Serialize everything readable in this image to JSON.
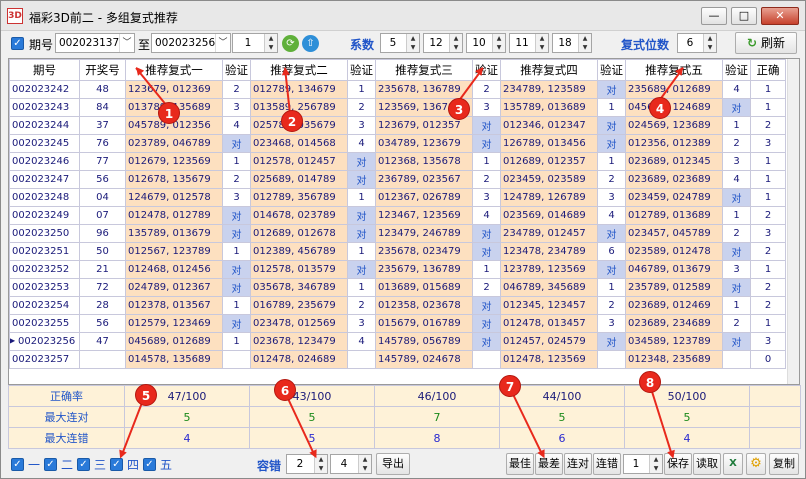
{
  "window": {
    "title": "福彩3D前二 - 多组复式推荐",
    "icon_name": "app-logo-icon",
    "min_label": "▭",
    "max_label": "▢",
    "close_label": "✕"
  },
  "toolbar": {
    "period_label": "期号",
    "period_from": "002023137",
    "to_label": "至",
    "period_to": "002023256",
    "step_value": "1",
    "coef_label": "系数",
    "coefs": [
      "5",
      "12",
      "10",
      "11",
      "18"
    ],
    "fushi_label": "复式位数",
    "fushi_value": "6",
    "refresh_label": "刷新"
  },
  "table": {
    "headers": [
      "期号",
      "开奖号",
      "推荐复式一",
      "验证",
      "推荐复式二",
      "验证",
      "推荐复式三",
      "验证",
      "推荐复式四",
      "验证",
      "推荐复式五",
      "验证",
      "正确"
    ],
    "rows": [
      [
        "002023242",
        "48",
        "123679, 012369",
        "2",
        "012789, 134679",
        "1",
        "235678, 136789",
        "2",
        "234789, 123589",
        "对",
        "235689, 012689",
        "4",
        "1"
      ],
      [
        "002023243",
        "84",
        "013789, 135689",
        "3",
        "013589, 256789",
        "2",
        "123569, 136789",
        "3",
        "135789, 013689",
        "1",
        "045678, 124689",
        "对",
        "1"
      ],
      [
        "002023244",
        "37",
        "045789, 012356",
        "4",
        "025789, 035679",
        "3",
        "123679, 012357",
        "对",
        "012346, 012347",
        "对",
        "024569, 123689",
        "1",
        "2"
      ],
      [
        "002023245",
        "76",
        "023789, 046789",
        "对",
        "023468, 014568",
        "4",
        "034789, 123679",
        "对",
        "126789, 013456",
        "对",
        "012356, 012389",
        "2",
        "3"
      ],
      [
        "002023246",
        "77",
        "012679, 123569",
        "1",
        "012578, 012457",
        "对",
        "012368, 135678",
        "1",
        "012689, 012357",
        "1",
        "023689, 012345",
        "3",
        "1"
      ],
      [
        "002023247",
        "56",
        "012678, 135679",
        "2",
        "025689, 014789",
        "对",
        "236789, 023567",
        "2",
        "023459, 023589",
        "2",
        "023689, 023689",
        "4",
        "1"
      ],
      [
        "002023248",
        "04",
        "124679, 012578",
        "3",
        "012789, 356789",
        "1",
        "012367, 026789",
        "3",
        "124789, 126789",
        "3",
        "023459, 024789",
        "对",
        "1"
      ],
      [
        "002023249",
        "07",
        "012478, 012789",
        "对",
        "014678, 023789",
        "对",
        "123467, 123569",
        "4",
        "023569, 014689",
        "4",
        "012789, 013689",
        "1",
        "2"
      ],
      [
        "002023250",
        "96",
        "135789, 013679",
        "对",
        "012689, 012678",
        "对",
        "123479, 246789",
        "对",
        "234789, 012457",
        "对",
        "023457, 045789",
        "2",
        "3"
      ],
      [
        "002023251",
        "50",
        "012567, 123789",
        "1",
        "012389, 456789",
        "1",
        "235678, 023479",
        "对",
        "123478, 234789",
        "6",
        "023589, 012478",
        "对",
        "2"
      ],
      [
        "002023252",
        "21",
        "012468, 012456",
        "对",
        "012578, 013579",
        "对",
        "235679, 136789",
        "1",
        "123789, 123569",
        "对",
        "046789, 013679",
        "3",
        "1"
      ],
      [
        "002023253",
        "72",
        "024789, 012367",
        "对",
        "035678, 346789",
        "1",
        "013689, 015689",
        "2",
        "046789, 345689",
        "1",
        "235789, 012589",
        "对",
        "2"
      ],
      [
        "002023254",
        "28",
        "012378, 013567",
        "1",
        "016789, 235679",
        "2",
        "012358, 023678",
        "对",
        "012345, 123457",
        "2",
        "023689, 012469",
        "1",
        "2"
      ],
      [
        "002023255",
        "56",
        "012579, 123469",
        "对",
        "023478, 012569",
        "3",
        "015679, 016789",
        "对",
        "012478, 013457",
        "3",
        "023689, 234689",
        "2",
        "1"
      ],
      [
        "002023256",
        "47",
        "045689, 012689",
        "1",
        "023678, 123479",
        "4",
        "145789, 056789",
        "对",
        "012457, 024579",
        "对",
        "034589, 123789",
        "对",
        "3"
      ],
      [
        "002023257",
        "",
        "014578, 135689",
        "",
        "012478, 024689",
        "",
        "145789, 024678",
        "",
        "012478, 123569",
        "",
        "012348, 235689",
        "",
        "0"
      ]
    ]
  },
  "summary": {
    "rows": [
      {
        "label": "正确率",
        "values": [
          "47/100",
          "43/100",
          "46/100",
          "44/100",
          "50/100"
        ]
      },
      {
        "label": "最大连对",
        "values": [
          "5",
          "5",
          "7",
          "5",
          "5"
        ]
      },
      {
        "label": "最大连错",
        "values": [
          "4",
          "5",
          "8",
          "6",
          "4"
        ]
      }
    ]
  },
  "bottom": {
    "groups": [
      "一",
      "二",
      "三",
      "四",
      "五"
    ],
    "tolerance_label": "容错",
    "tol_from": "2",
    "tol_to": "4",
    "export_label": "导出",
    "best_label": "最佳",
    "worst_label": "最差",
    "consec_hit_label": "连对",
    "consec_miss_label": "连错",
    "consec_value": "1",
    "save_label": "保存",
    "load_label": "读取",
    "copy_label": "复制"
  },
  "badges": [
    "1",
    "2",
    "3",
    "4",
    "5",
    "6",
    "7",
    "8"
  ],
  "colors": {
    "accent": "#2155c8",
    "recommend_bg": "#fde0c0",
    "hit_bg": "#c9d2ee",
    "badge": "#e8291c"
  }
}
